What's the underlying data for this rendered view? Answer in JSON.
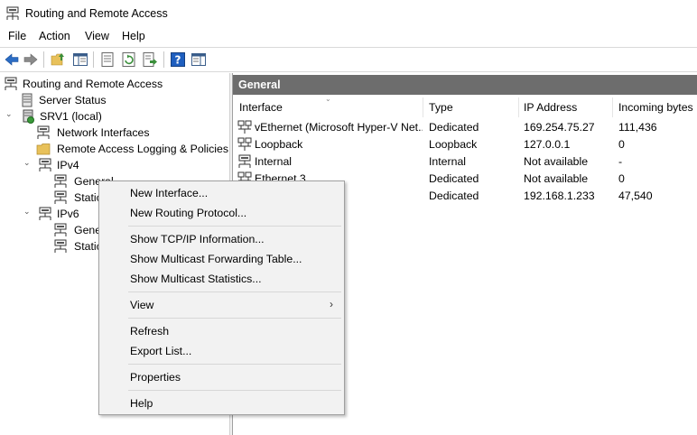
{
  "window": {
    "title": "Routing and Remote Access"
  },
  "menubar": {
    "items": [
      "File",
      "Action",
      "View",
      "Help"
    ]
  },
  "toolbar": {
    "buttons": [
      "back-arrow-icon",
      "forward-arrow-icon",
      "up-folder-icon",
      "show-hide-tree-icon",
      "properties-icon",
      "refresh-icon",
      "export-list-icon",
      "help-icon",
      "action-pane-icon"
    ]
  },
  "tree": {
    "root": "Routing and Remote Access",
    "server_status": "Server Status",
    "server": "SRV1 (local)",
    "network_interfaces": "Network Interfaces",
    "logging": "Remote Access Logging & Policies",
    "ipv4": {
      "label": "IPv4",
      "general": "General",
      "static_routes": "Static Routes"
    },
    "ipv6": {
      "label": "IPv6",
      "general": "General",
      "static_routes": "Static Routes"
    }
  },
  "detail": {
    "header": "General",
    "columns": [
      "Interface",
      "Type",
      "IP Address",
      "Incoming bytes"
    ],
    "rows": [
      {
        "interface": "vEthernet (Microsoft Hyper-V Net...",
        "type": "Dedicated",
        "ip": "169.254.75.27",
        "incoming": "111,436"
      },
      {
        "interface": "Loopback",
        "type": "Loopback",
        "ip": "127.0.0.1",
        "incoming": "0"
      },
      {
        "interface": "Internal",
        "type": "Internal",
        "ip": "Not available",
        "incoming": "-"
      },
      {
        "interface": "Ethernet 3",
        "type": "Dedicated",
        "ip": "Not available",
        "incoming": "0"
      },
      {
        "interface": "",
        "type": "Dedicated",
        "ip": "192.168.1.233",
        "incoming": "47,540"
      }
    ]
  },
  "context_menu": {
    "new_interface": "New Interface...",
    "new_routing_protocol": "New Routing Protocol...",
    "show_tcpip": "Show TCP/IP Information...",
    "show_mcast_fwd": "Show Multicast Forwarding Table...",
    "show_mcast_stats": "Show Multicast Statistics...",
    "view": "View",
    "view_arrow": "›",
    "refresh": "Refresh",
    "export_list": "Export List...",
    "properties": "Properties",
    "help": "Help"
  },
  "colors": {
    "header_bg": "#6d6d6d",
    "menu_bg": "#f2f2f2",
    "toolbar_blue": "#2b6cc4"
  }
}
